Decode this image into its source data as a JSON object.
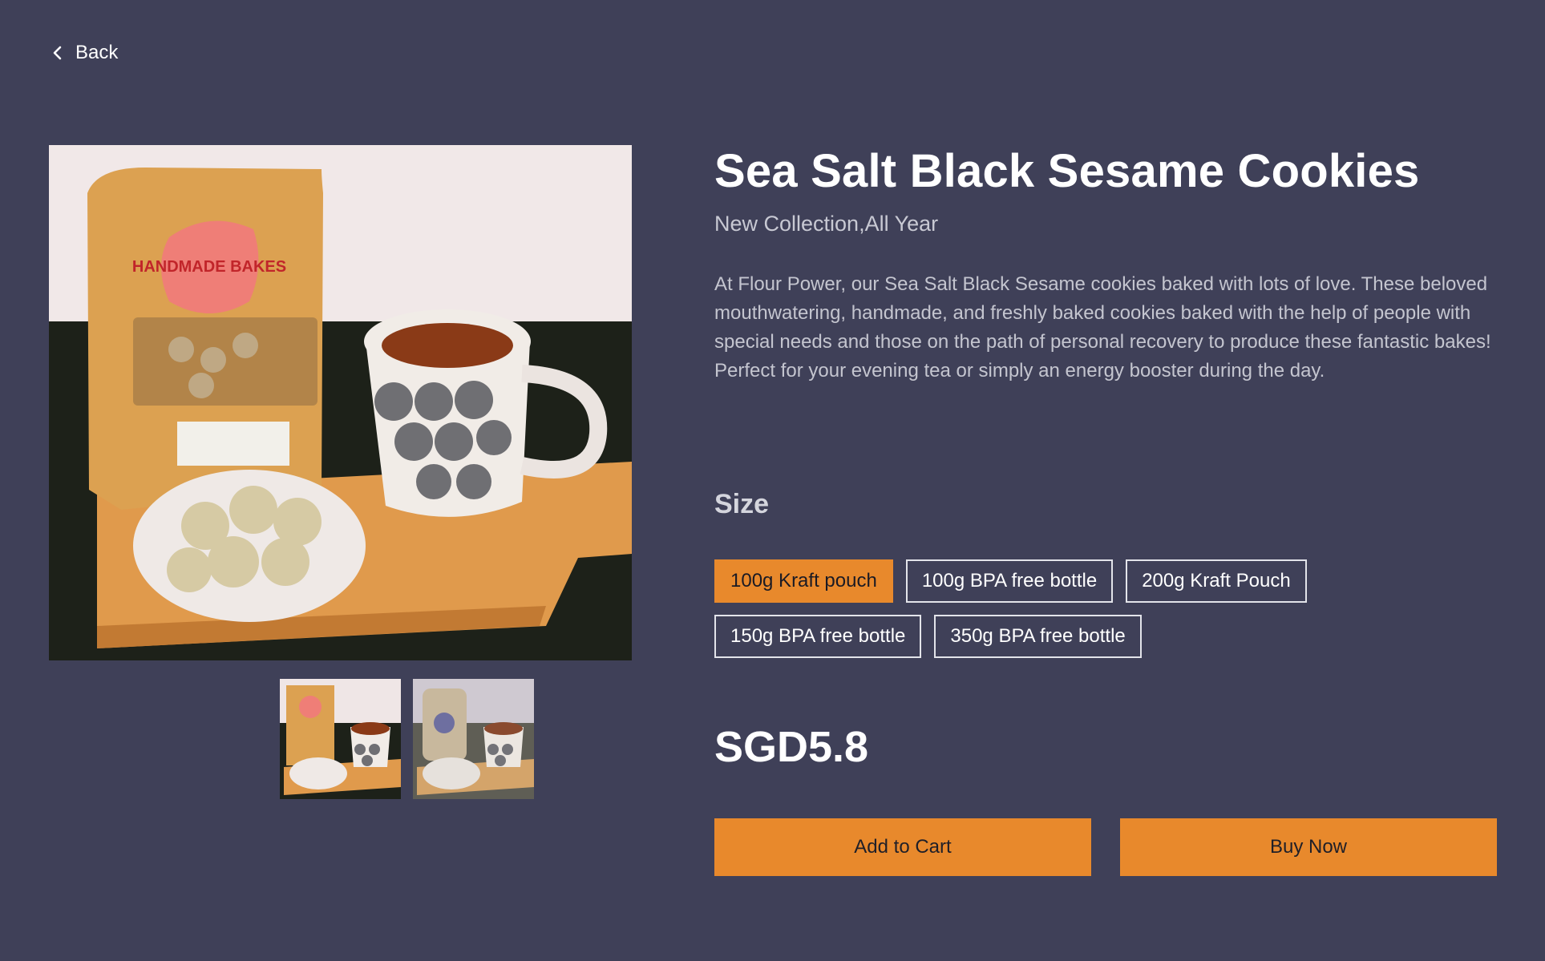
{
  "nav": {
    "back_label": "Back",
    "back_icon": "chevron-left-icon"
  },
  "product": {
    "title": "Sea Salt Black Sesame Cookies",
    "subtitle": "New Collection,All Year",
    "description": "At Flour Power, our Sea Salt Black Sesame cookies baked with lots of love. These beloved mouthwatering, handmade, and freshly baked cookies baked with the help of people with special needs and those on the path of personal recovery to produce these fantastic bakes! Perfect for your evening tea or simply an energy booster during the day.",
    "size_label": "Size",
    "sizes": [
      {
        "label": "100g Kraft pouch",
        "selected": true
      },
      {
        "label": "100g BPA free bottle",
        "selected": false
      },
      {
        "label": "200g Kraft Pouch",
        "selected": false
      },
      {
        "label": "150g BPA free bottle",
        "selected": false
      },
      {
        "label": "350g BPA free bottle",
        "selected": false
      }
    ],
    "price": "SGD5.8",
    "image_packaging_text": "HANDMADE BAKES"
  },
  "actions": {
    "add_to_cart": "Add to Cart",
    "buy_now": "Buy Now"
  },
  "colors": {
    "background": "#3f4058",
    "accent": "#e8892c"
  }
}
